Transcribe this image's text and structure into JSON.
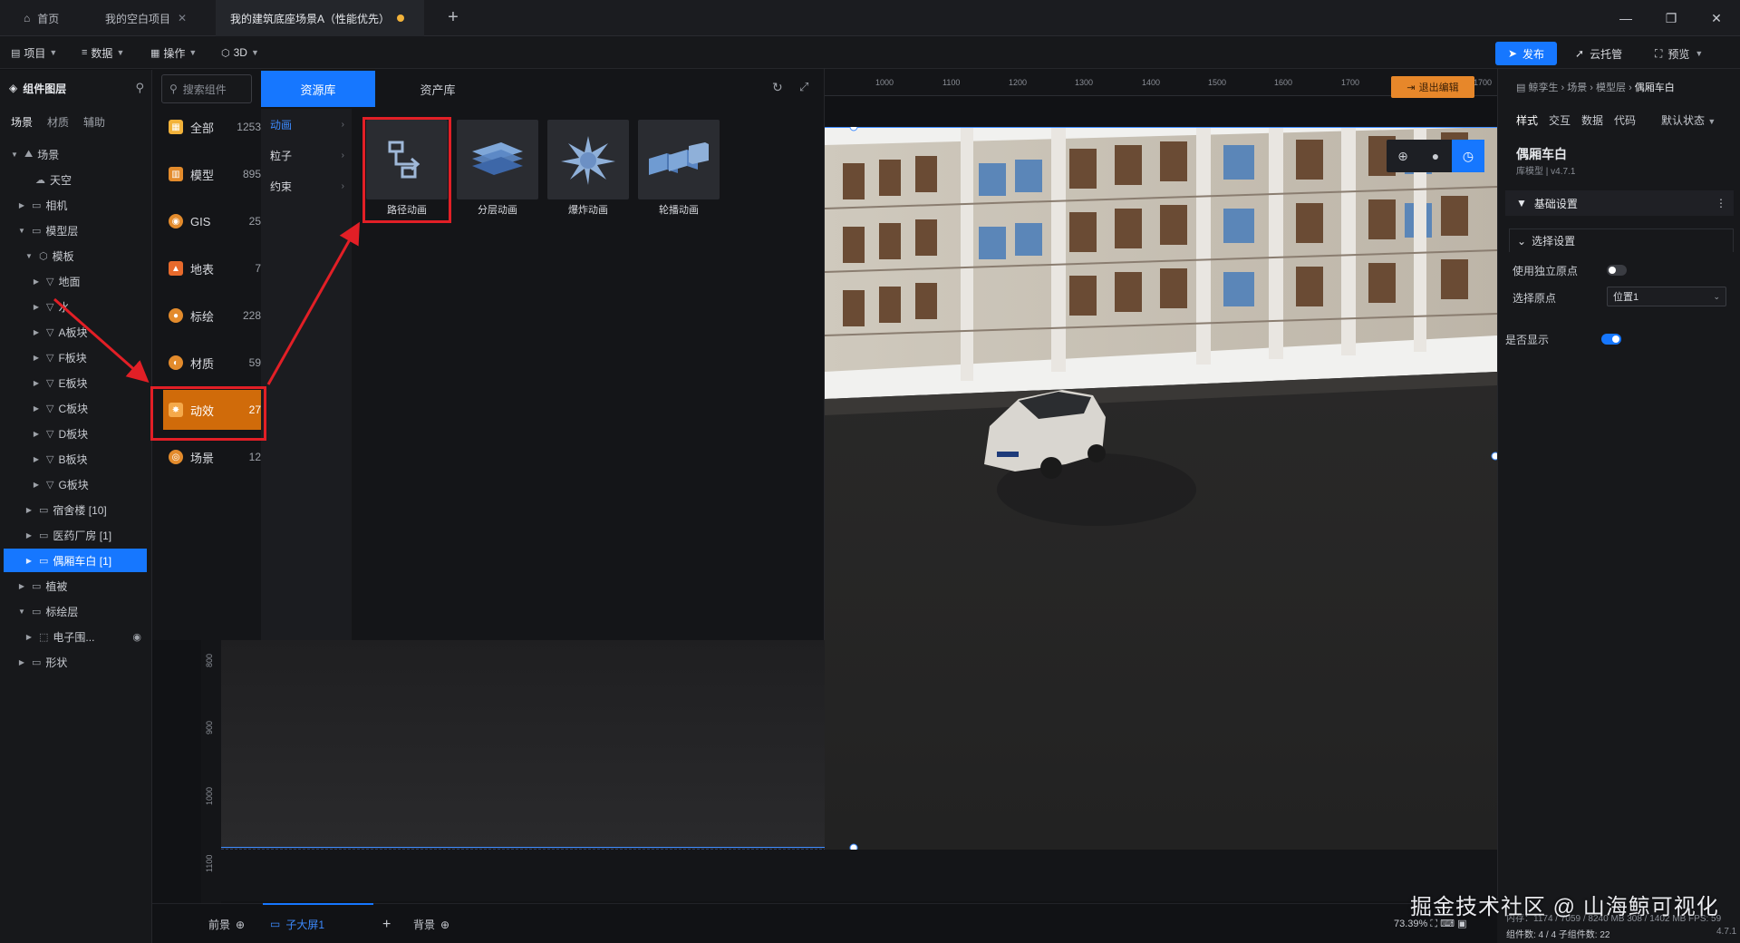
{
  "tabs": [
    {
      "label": "首页"
    },
    {
      "label": "我的空白项目"
    },
    {
      "label": "我的建筑底座场景A（性能优先）"
    }
  ],
  "menubar": {
    "items": [
      {
        "label": "项目"
      },
      {
        "label": "数据"
      },
      {
        "label": "操作"
      },
      {
        "label": "3D"
      }
    ],
    "publish": "发布",
    "cloud": "云托管",
    "preview": "预览"
  },
  "left": {
    "title": "组件图层",
    "tabs": [
      "场景",
      "材质",
      "辅助"
    ],
    "tree": [
      {
        "label": "场景"
      },
      {
        "label": "天空"
      },
      {
        "label": "相机"
      },
      {
        "label": "模型层"
      },
      {
        "label": "模板"
      },
      {
        "label": "地面"
      },
      {
        "label": "水"
      },
      {
        "label": "A板块"
      },
      {
        "label": "F板块"
      },
      {
        "label": "E板块"
      },
      {
        "label": "C板块"
      },
      {
        "label": "D板块"
      },
      {
        "label": "B板块"
      },
      {
        "label": "G板块"
      },
      {
        "label": "宿舍楼 [10]"
      },
      {
        "label": "医药厂房 [1]"
      },
      {
        "label": "偶厢车白 [1]"
      },
      {
        "label": "植被"
      },
      {
        "label": "标绘层"
      },
      {
        "label": "电子围..."
      },
      {
        "label": "形状"
      }
    ]
  },
  "popup": {
    "search_placeholder": "搜索组件",
    "tab_resource": "资源库",
    "tab_asset": "资产库",
    "categories": [
      {
        "label": "全部",
        "count": "1253",
        "color": "#f2b23a"
      },
      {
        "label": "模型",
        "count": "895",
        "color": "#e38b2c"
      },
      {
        "label": "GIS",
        "count": "25",
        "color": "#e38b2c"
      },
      {
        "label": "地表",
        "count": "7",
        "color": "#e86a2c"
      },
      {
        "label": "标绘",
        "count": "228",
        "color": "#e38b2c"
      },
      {
        "label": "材质",
        "count": "59",
        "color": "#e38b2c"
      },
      {
        "label": "动效",
        "count": "27",
        "color": "#f5a94a"
      },
      {
        "label": "场景",
        "count": "12",
        "color": "#e38b2c"
      }
    ],
    "subcats": [
      {
        "label": "动画"
      },
      {
        "label": "粒子"
      },
      {
        "label": "约束"
      }
    ],
    "cards": [
      {
        "label": "路径动画"
      },
      {
        "label": "分层动画"
      },
      {
        "label": "爆炸动画"
      },
      {
        "label": "轮播动画"
      }
    ]
  },
  "viewport": {
    "exit_edit": "退出编辑",
    "ruler_top": [
      "1000",
      "1100",
      "1200",
      "1300",
      "1400",
      "1500",
      "1600",
      "1700",
      "1700"
    ],
    "ruler_left": [
      "800",
      "900",
      "1000",
      "1100"
    ]
  },
  "right": {
    "breadcrumb": {
      "root": "鲸孪生",
      "p1": "场景",
      "p2": "模型层",
      "current": "偶厢车白"
    },
    "tabs": [
      "样式",
      "交互",
      "数据",
      "代码"
    ],
    "state": "默认状态",
    "name": "偶厢车白",
    "subtitle": "库模型 | v4.7.1",
    "section_basic": "基础设置",
    "section_select": "选择设置",
    "use_origin_label": "使用独立原点",
    "use_origin": false,
    "select_origin_label": "选择原点",
    "select_origin_value": "位置1",
    "visible_label": "是否显示",
    "visible": true
  },
  "bottom": {
    "front": "前景",
    "subscreen": "子大屏1",
    "add": "+",
    "bg": "背景",
    "zoom": "73.39%",
    "watermark": "掘金技术社区 @ 山海鲸可视化",
    "memory": "内存：1174 / 7059 / 8240 MB  308 / 1402 MB FPS: 59",
    "components": "组件数: 4 / 4    子组件数: 22",
    "version": "4.7.1"
  }
}
